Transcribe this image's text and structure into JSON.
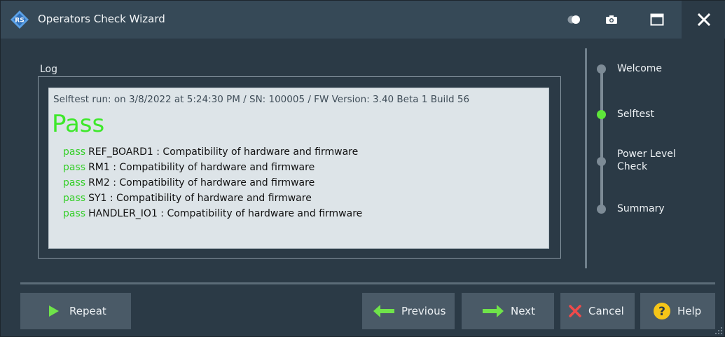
{
  "window": {
    "title": "Operators Check Wizard",
    "icons": [
      "rs-logo-icon",
      "toggle-icon",
      "camera-icon",
      "maximize-icon",
      "close-icon"
    ]
  },
  "log": {
    "caption": "Log",
    "header": "Selftest run: on 3/8/2022 at 5:24:30 PM / SN: 100005 / FW Version: 3.40 Beta 1 Build 56",
    "result": "Pass",
    "entries": [
      {
        "status": "pass",
        "text": "REF_BOARD1 : Compatibility of hardware and firmware"
      },
      {
        "status": "pass",
        "text": "RM1 : Compatibility of hardware and firmware"
      },
      {
        "status": "pass",
        "text": "RM2 : Compatibility of hardware and firmware"
      },
      {
        "status": "pass",
        "text": "SY1 : Compatibility of hardware and firmware"
      },
      {
        "status": "pass",
        "text": "HANDLER_IO1 : Compatibility of hardware and firmware"
      }
    ]
  },
  "steps": [
    {
      "label": "Welcome",
      "active": false
    },
    {
      "label": "Selftest",
      "active": true
    },
    {
      "label": "Power Level Check",
      "active": false
    },
    {
      "label": "Summary",
      "active": false
    }
  ],
  "buttons": {
    "repeat": "Repeat",
    "previous": "Previous",
    "next": "Next",
    "cancel": "Cancel",
    "help": "Help"
  },
  "colors": {
    "pass_green": "#3ee82b",
    "active_step": "#5ee53a",
    "arrow_green": "#6fe34a",
    "cancel_red": "#f04a4a",
    "help_yellow": "#f5c518"
  }
}
